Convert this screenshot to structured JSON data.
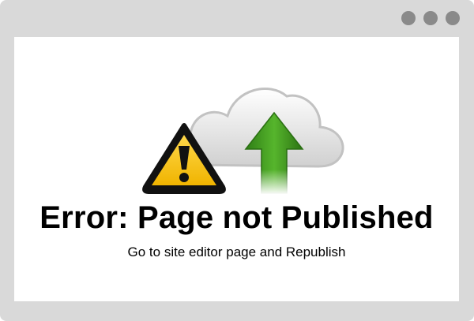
{
  "window": {
    "controls": [
      "window-dot-icon",
      "window-dot-icon",
      "window-dot-icon"
    ]
  },
  "error": {
    "title": "Error: Page not Published",
    "message": "Go to site editor page and Republish"
  },
  "icons": {
    "illustration": "cloud-upload-warning-illustration",
    "warning": "warning-triangle-icon",
    "cloud": "cloud-icon",
    "arrow": "upload-arrow-icon"
  },
  "colors": {
    "frame": "#d9d9d9",
    "window_dots": "#8a8a8a",
    "warning_yellow": "#f2c200",
    "arrow_green": "#3f9a22"
  }
}
